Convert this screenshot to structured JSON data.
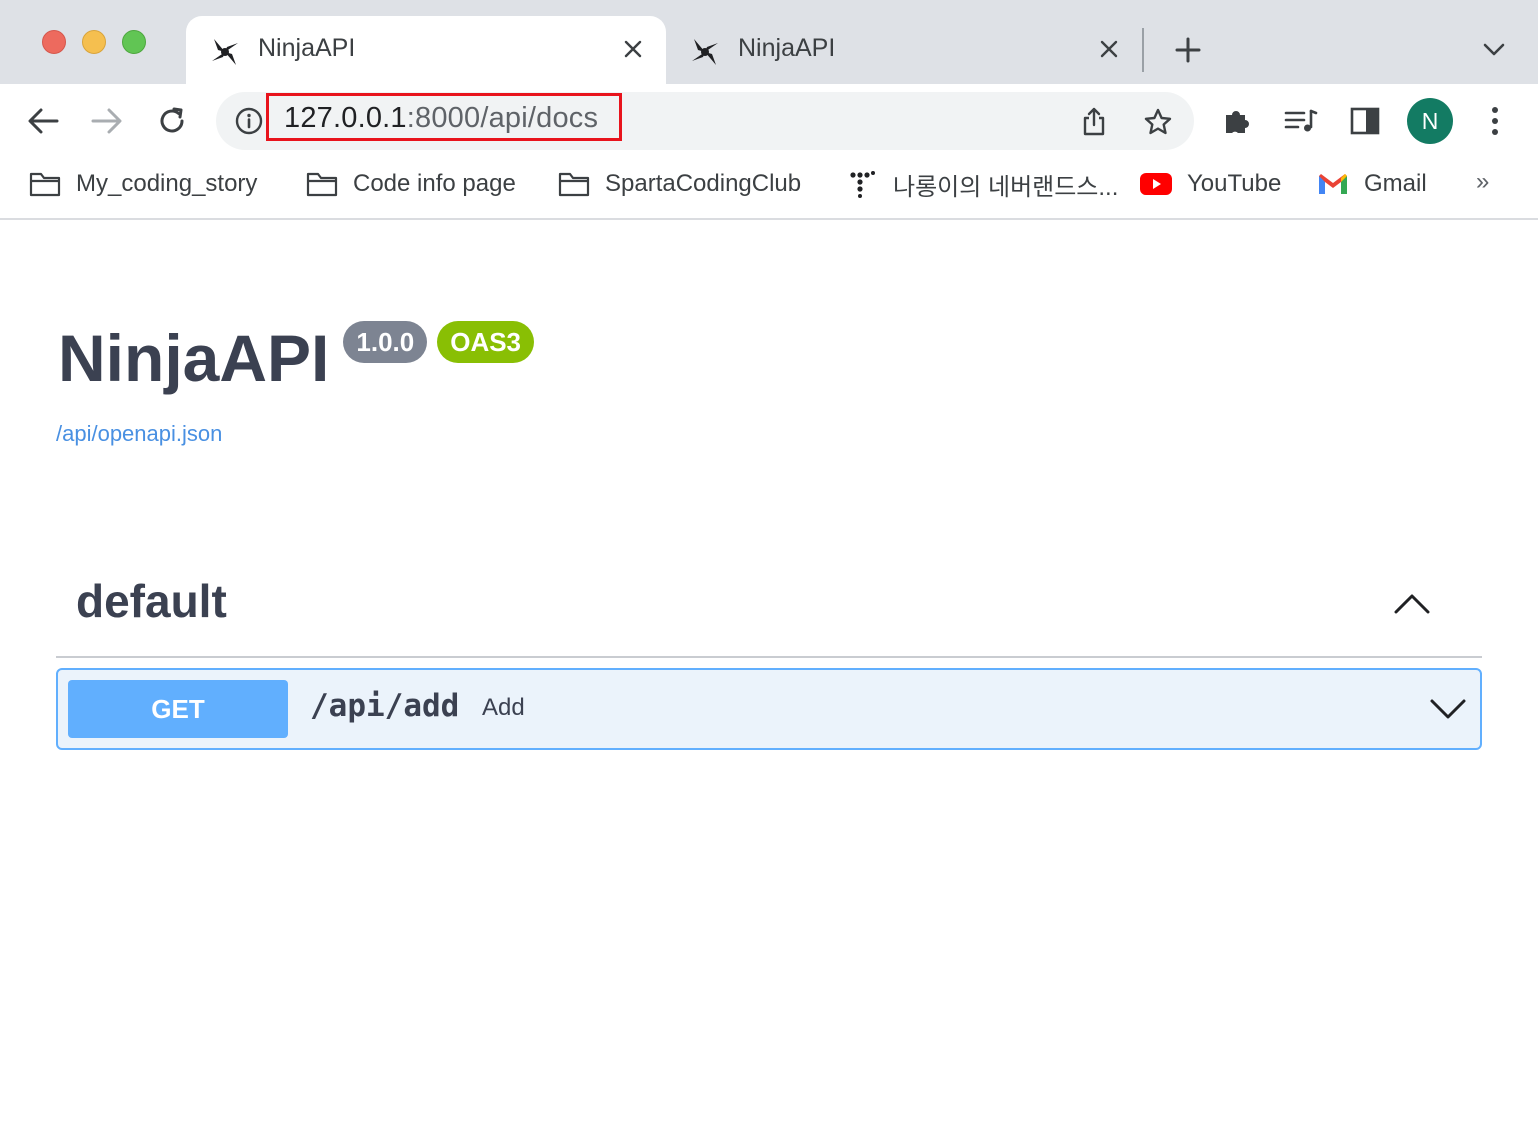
{
  "browser": {
    "tabs": [
      {
        "title": "NinjaAPI",
        "active": true
      },
      {
        "title": "NinjaAPI",
        "active": false
      }
    ],
    "url": {
      "host": "127.0.0.1",
      "path": ":8000/api/docs"
    },
    "profile_initial": "N",
    "bookmarks": [
      {
        "label": "My_coding_story",
        "icon": "folder-icon"
      },
      {
        "label": "Code info page",
        "icon": "folder-icon"
      },
      {
        "label": "SpartaCodingClub",
        "icon": "folder-icon"
      },
      {
        "label": "나롱이의 네버랜드스...",
        "icon": "dots-logo-icon"
      },
      {
        "label": "YouTube",
        "icon": "youtube-icon"
      },
      {
        "label": "Gmail",
        "icon": "gmail-icon"
      }
    ],
    "bookmarks_overflow": "»"
  },
  "swagger": {
    "title": "NinjaAPI",
    "version": "1.0.0",
    "oas_badge": "OAS3",
    "spec_link": "/api/openapi.json",
    "tag": "default",
    "operations": [
      {
        "method": "GET",
        "path": "/api/add",
        "summary": "Add"
      }
    ]
  },
  "colors": {
    "accent_get": "#61affe",
    "url_highlight": "#e8131c",
    "oas_green": "#89bf04",
    "version_gray": "#7d8492"
  }
}
